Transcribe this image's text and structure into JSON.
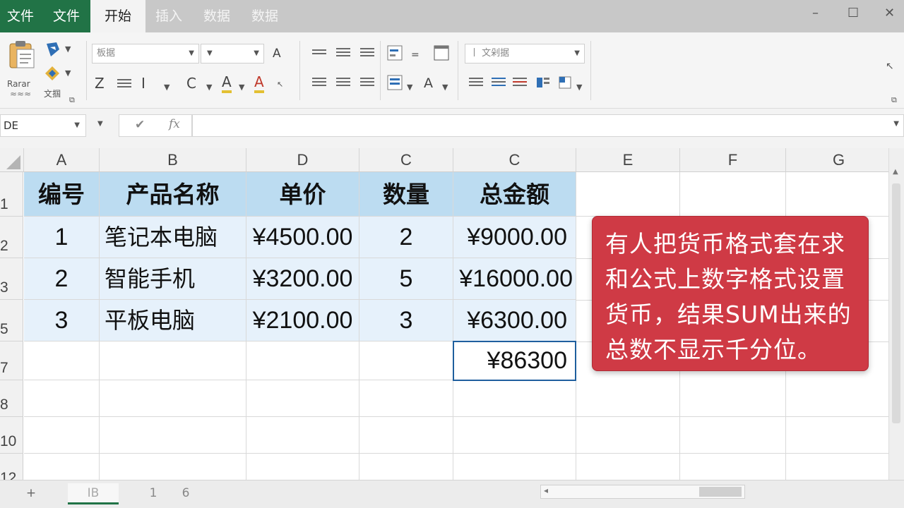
{
  "tabs": [
    "文件",
    "文件",
    "开始",
    "插入",
    "数据",
    "数据"
  ],
  "window_controls": {
    "minimize": "–",
    "maximize": "☐",
    "close": "✕"
  },
  "ribbon": {
    "paste_label": "Rarar",
    "paste_sub": "≈≈≈",
    "format_label": "文掴",
    "font_name": "板据",
    "style_combo": "丨 文剁据",
    "bold_like": "Z",
    "italic_like": "I",
    "c_like": "C",
    "font_color": "A",
    "grow_font": "A",
    "fill_color": "A",
    "font_a": "A",
    "pointer": "↖"
  },
  "formula_bar": {
    "name_box": "DE",
    "fx": "fx",
    "check": "✔"
  },
  "columns": [
    "A",
    "B",
    "D",
    "C",
    "C",
    "E",
    "F",
    "G"
  ],
  "rows": [
    "1",
    "2",
    "3",
    "5",
    "7",
    "8",
    "10",
    "12"
  ],
  "table": {
    "header": [
      "编号",
      "产品名称",
      "单价",
      "数量",
      "总金额"
    ],
    "rows": [
      [
        "1",
        "笔记本电脑",
        "¥4500.00",
        "2",
        "¥9000.00"
      ],
      [
        "2",
        "智能手机",
        "¥3200.00",
        "5",
        "¥16000.00"
      ],
      [
        "3",
        "平板电脑",
        "¥2100.00",
        "3",
        "¥6300.00"
      ]
    ],
    "total": "¥86300"
  },
  "callout": "有人把货币格式套在求和公式上数字格式设置货币，结果SUM出来的总数不显示千分位。",
  "sheets": {
    "add": "+",
    "tabs": [
      "IB",
      "1",
      "6"
    ]
  },
  "scroll_left": "◂"
}
